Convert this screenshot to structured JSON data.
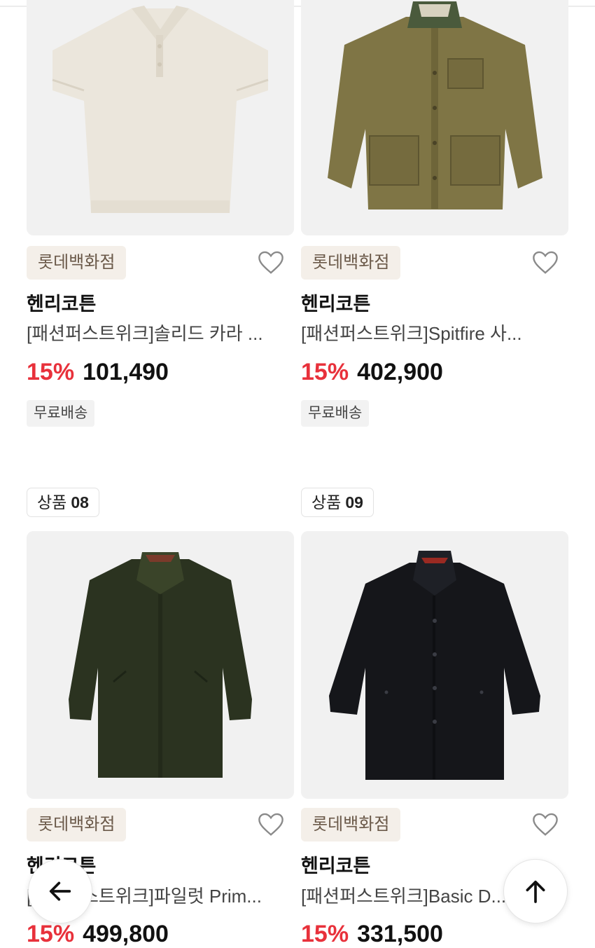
{
  "products": [
    {
      "store": "롯데백화점",
      "brand": "헨리코튼",
      "name": "[패션퍼스트위크]솔리드 카라 ...",
      "discount": "15%",
      "price": "101,490",
      "shipping": "무료배송",
      "image": "cream-polo-shirt"
    },
    {
      "store": "롯데백화점",
      "brand": "헨리코튼",
      "name": "[패션퍼스트위크]Spitfire 사...",
      "discount": "15%",
      "price": "402,900",
      "shipping": "무료배송",
      "image": "khaki-field-jacket"
    },
    {
      "rank_label": "상품",
      "rank_num": "08",
      "store": "롯데백화점",
      "brand": "헨리코튼",
      "name": "[패션퍼스트위크]파일럿 Prim...",
      "discount": "15%",
      "price": "499,800",
      "image": "dark-olive-coat"
    },
    {
      "rank_label": "상품",
      "rank_num": "09",
      "store": "롯데백화점",
      "brand": "헨리코튼",
      "name": "[패션퍼스트위크]Basic D...",
      "discount": "15%",
      "price": "331,500",
      "image": "black-coat"
    }
  ],
  "controls": {
    "back_icon": "arrow-left-icon",
    "top_icon": "arrow-up-icon"
  },
  "colors": {
    "discount": "#e8313b",
    "store_badge_bg": "#f4efe9",
    "store_badge_text": "#6b5a4a"
  }
}
